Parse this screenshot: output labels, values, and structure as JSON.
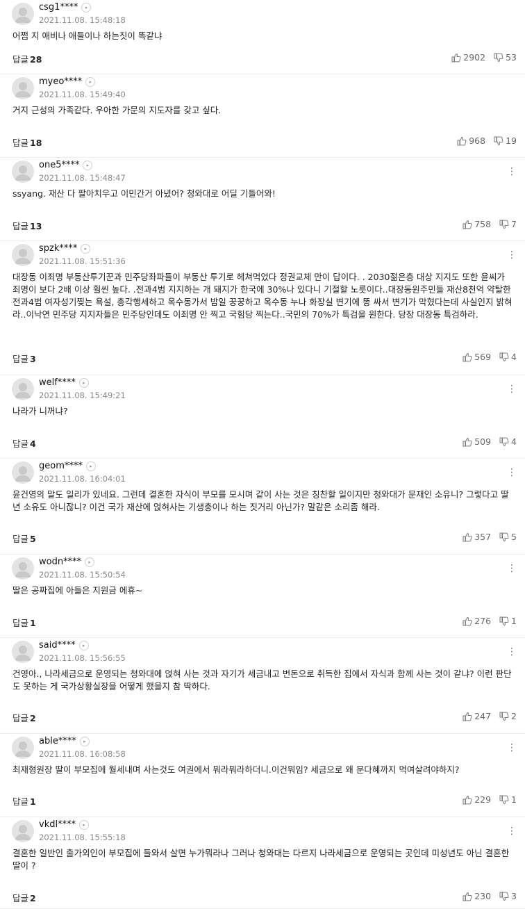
{
  "comments": [
    {
      "nick": "csg1****",
      "date": "2021.11.08. 15:48:18",
      "text": "어쩜 지 애비나 애들이나 하는짓이 똑같냐",
      "reply_label": "답글",
      "reply_count": "28",
      "likes": "2902",
      "dislikes": "53",
      "show_more": false
    },
    {
      "nick": "myeo****",
      "date": "2021.11.08. 15:49:40",
      "text": "거지 근성의 가족같다. 우아한 가문의 지도자를 갖고 싶다.",
      "reply_label": "답글",
      "reply_count": "18",
      "likes": "968",
      "dislikes": "19",
      "show_more": false
    },
    {
      "nick": "one5****",
      "date": "2021.11.08. 15:48:47",
      "text": "ssyang. 재산 다 팔아치우고 이민간거 아녔어? 청와대로 어딜 기들어와!",
      "reply_label": "답글",
      "reply_count": "13",
      "likes": "758",
      "dislikes": "7",
      "show_more": true
    },
    {
      "nick": "spzk****",
      "date": "2021.11.08. 15:51:36",
      "text": "대장동 이죄명 부동산투기꾼과 민주당좌파들이 부동산 투기로 헤쳐먹었다 정권교체 만이 답이다. . 2030젊은층 대상 지지도 또한 윤씨가 죄명이 보다 2배 이상 훨씬 높다. .전과4범 지지하는 개 돼지가 한국에 30%나 있다니 기절할 노릇이다..대장동원주민들 재산8천억 약탈한 전과4범 여자성기찢는 욕설, 총각행세하고 옥수동가서 밤일 꿍꿍하고 옥수동 누나 화장실 변기에 똥 싸서 변기가 막혔다는데 사실인지 밝혀라..이낙연 민주당 지지자들은 민주당인데도 이죄명 안 찍고 국힘당 찍는다..국민의 70%가 특검을 원한다. 당장 대장동 특검하라.",
      "reply_label": "답글",
      "reply_count": "3",
      "likes": "569",
      "dislikes": "4",
      "show_more": true
    },
    {
      "nick": "welf****",
      "date": "2021.11.08. 15:49:21",
      "text": "나라가 니꺼냐?",
      "reply_label": "답글",
      "reply_count": "4",
      "likes": "509",
      "dislikes": "4",
      "show_more": true
    },
    {
      "nick": "geom****",
      "date": "2021.11.08. 16:04:01",
      "text": "윤건영의 말도 일리가 있네요. 그런데 결혼한 자식이 부모를 모시며 같이 사는 것은 칭찬할 일이지만 청와대가 문재인 소유니? 그렇다고 딸년 소유도 아니잖니? 이건 국가 재산에 얹혀사는 기생충이나 하는 짓거리 아닌가? 말같은 소리좀 해라.",
      "reply_label": "답글",
      "reply_count": "5",
      "likes": "357",
      "dislikes": "5",
      "show_more": true
    },
    {
      "nick": "wodn****",
      "date": "2021.11.08. 15:50:54",
      "text": "딸은 공짜집에 아들은 지원금 에휴~",
      "reply_label": "답글",
      "reply_count": "1",
      "likes": "276",
      "dislikes": "1",
      "show_more": true
    },
    {
      "nick": "said****",
      "date": "2021.11.08. 15:56:55",
      "text": "건영아., 나라세금으로 운영되는 청와대에 얹혀 사는 것과 자기가 세금내고 번돈으로 취득한 집에서 자식과 함께 사는 것이 같냐? 이런 판단도 못하는 게 국가상황실장을 어떻게 했을지 참 딱하다.",
      "reply_label": "답글",
      "reply_count": "2",
      "likes": "247",
      "dislikes": "2",
      "show_more": true
    },
    {
      "nick": "able****",
      "date": "2021.11.08. 16:08:58",
      "text": "최재형원장 딸이 부모집에 월세내며 사는것도 여권에서 뭐라뭐라하더니.이건뭐임? 세금으로 왜 문다혜까지 먹여살려야하지?",
      "reply_label": "답글",
      "reply_count": "1",
      "likes": "229",
      "dislikes": "1",
      "show_more": true
    },
    {
      "nick": "vkdl****",
      "date": "2021.11.08. 15:55:18",
      "text": "결혼한 일반인 출가외인이 부모집에 들와서 살면 누가뭐라나 그러나 청와대는 다르지 나라세금으로 운영되는 곳인데 미성년도 아닌 결혼한 딸이 ?",
      "reply_label": "답글",
      "reply_count": "2",
      "likes": "230",
      "dislikes": "3",
      "show_more": true
    }
  ]
}
